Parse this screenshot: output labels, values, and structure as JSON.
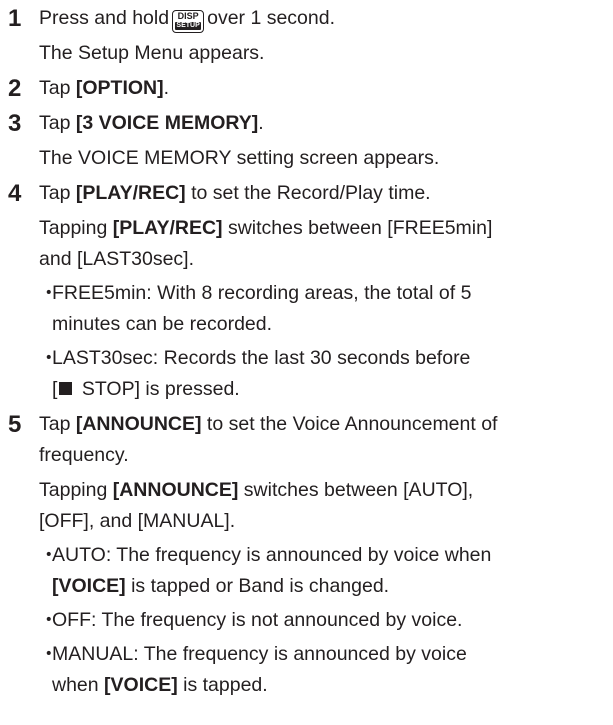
{
  "steps": [
    {
      "num": "1",
      "pre": "Press and hold",
      "key": {
        "top": "DISP",
        "bottom": "SETUP"
      },
      "post": "over 1 second.",
      "result": "The Setup Menu appears."
    },
    {
      "num": "2",
      "pre": "Tap ",
      "bold": "[OPTION]",
      "post": "."
    },
    {
      "num": "3",
      "pre": "Tap ",
      "bold": "[3 VOICE MEMORY]",
      "post": ".",
      "result": "The VOICE MEMORY setting screen appears."
    },
    {
      "num": "4",
      "pre": "Tap ",
      "bold": "[PLAY/REC]",
      "post": " to set the Record/Play time.",
      "detail_pre": "Tapping ",
      "detail_bold": "[PLAY/REC]",
      "detail_l1": " switches between [FREE5min]",
      "detail_l2": "and [LAST30sec].",
      "bullets": [
        {
          "dot": "・",
          "l1": "FREE5min: With 8 recording areas, the total of 5",
          "l2": "minutes can be recorded."
        },
        {
          "dot": "・",
          "l1": "LAST30sec: Records the last 30 seconds before",
          "l2_pre": "[",
          "l2_post": " STOP] is pressed."
        }
      ]
    },
    {
      "num": "5",
      "pre": "Tap ",
      "bold": "[ANNOUNCE]",
      "post": " to set the Voice Announcement of",
      "post_l2": "frequency.",
      "detail_pre": "Tapping ",
      "detail_bold": "[ANNOUNCE]",
      "detail_l1": " switches between [AUTO],",
      "detail_l2": "[OFF], and [MANUAL].",
      "bullets": [
        {
          "dot": "・",
          "l1": "AUTO: The frequency is announced by voice when",
          "l2_bold": "[VOICE]",
          "l2_post": " is tapped or Band is changed."
        },
        {
          "dot": "・",
          "l1": "OFF: The frequency is not announced by voice."
        },
        {
          "dot": "・",
          "l1": "MANUAL: The frequency is announced by voice",
          "l2_pre": "when ",
          "l2_bold": "[VOICE]",
          "l2_post": " is tapped."
        }
      ]
    }
  ]
}
